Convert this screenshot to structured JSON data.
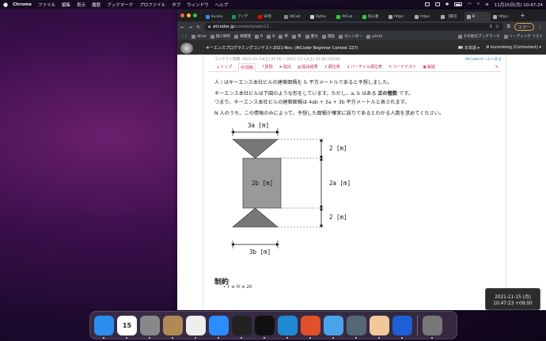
{
  "menubar": {
    "app": "Chrome",
    "menus": [
      "ファイル",
      "編集",
      "表示",
      "履歴",
      "ブックマーク",
      "プロファイル",
      "タブ",
      "ウィンドウ",
      "ヘルプ"
    ],
    "datetime": "11月15日(月) 10:47:24"
  },
  "browser": {
    "tabs": [
      {
        "label": "kuroro",
        "color": "#4285f4"
      },
      {
        "label": "アイデ",
        "color": "#0f9d58"
      },
      {
        "label": "90年",
        "color": "#ff0000"
      },
      {
        "label": "AtCod",
        "color": "#888888"
      },
      {
        "label": "Pytho",
        "color": "#cccccc"
      },
      {
        "label": "AtCod",
        "color": "#2ecc40"
      },
      {
        "label": "初心者",
        "color": "#2ecc40"
      },
      {
        "label": "https:",
        "color": "#aaaaaa"
      },
      {
        "label": "https:",
        "color": "#aaaaaa"
      },
      {
        "label": "【東京",
        "color": "#aaaaaa"
      },
      {
        "label": "B",
        "color": "#aaaaaa",
        "active": true
      },
      {
        "label": "https:",
        "color": "#aaaaaa"
      }
    ],
    "url_host": "atcoder.jp",
    "url_path": "/contests/abc22...",
    "error_pill": "エラー",
    "bookmarks": [
      {
        "label": "drive"
      },
      {
        "label": "個人制作"
      },
      {
        "label": "株関連"
      },
      {
        "label": "R"
      },
      {
        "label": "B"
      },
      {
        "label": "帝"
      },
      {
        "label": "青"
      },
      {
        "label": "書文"
      },
      {
        "label": "漫画"
      },
      {
        "label": "カレンダー"
      },
      {
        "label": "yenta"
      },
      {
        "label": "その他のブックマーク"
      },
      {
        "label": "リーディング リスト"
      }
    ]
  },
  "atcoder": {
    "contest_title": "キーエンスプログラミングコンテスト2021-Nov. (AtCoder Beginner Contest 227)",
    "language": "日本語",
    "user": "kurorobiog (Contestant)",
    "contest_time": "コンテスト時間: 2021-11-13(土) 21:00 ~ 2021-11-13(土) 22:40 (100分)",
    "home_link": "AtCoderホームへ戻る",
    "nav_tabs": [
      {
        "icon": "home-icon",
        "glyph": "⌂",
        "label": "トップ"
      },
      {
        "icon": "list-icon",
        "glyph": "▤",
        "label": "問題",
        "active": true
      },
      {
        "icon": "question-icon",
        "glyph": "?",
        "label": "質問"
      },
      {
        "icon": "send-icon",
        "glyph": "➤",
        "label": "提出"
      },
      {
        "icon": "submissions-icon",
        "glyph": "▤",
        "label": "提出結果"
      },
      {
        "icon": "ranking-icon",
        "glyph": "↕",
        "label": "順位表"
      },
      {
        "icon": "virtual-ranking-icon",
        "glyph": "↕",
        "label": "バーチャル順位表"
      },
      {
        "icon": "code-icon",
        "glyph": "✎",
        "label": "コードテスト"
      },
      {
        "icon": "book-icon",
        "glyph": "▣",
        "label": "解説"
      }
    ],
    "statement": {
      "line1": "人 i はキーエンス本社ビルの建築面積を Sᵢ 平方メートルであると予想しました。",
      "line2a": "キーエンス本社ビルは下図のような形をしています。ただし、a, b はある ",
      "line2b": "正の整数",
      "line2c": " です。",
      "line3": "つまり、キーエンス本社ビルの建築面積は 4ab + 3a + 3b 平方メートルと表されます。",
      "line4": "N 人のうち、この情報のみによって、予想した面積が確実に誤りであるとわかる人数を求めてください。"
    },
    "figure": {
      "top_width": "3a [m]",
      "bottom_width": "3b [m]",
      "rect_label": "2b [m]",
      "top_height": "2 [m]",
      "middle_height": "2a [m]",
      "bottom_height": "2 [m]"
    },
    "constraints_heading": "制約",
    "constraint1": "1 ≤ N ≤ 20"
  },
  "dock": [
    {
      "name": "finder-icon",
      "color": "#2a8ef0"
    },
    {
      "name": "calendar-icon",
      "color": "#ffffff",
      "text": "15"
    },
    {
      "name": "system-preferences-icon",
      "color": "#888888"
    },
    {
      "name": "contacts-icon",
      "color": "#b08a55"
    },
    {
      "name": "chrome-icon",
      "color": "#eeeeee"
    },
    {
      "name": "zoom-icon",
      "color": "#2d8cff"
    },
    {
      "name": "terminal-icon",
      "color": "#222222"
    },
    {
      "name": "terminal-alt-icon",
      "color": "#111111"
    },
    {
      "name": "vscode-icon",
      "color": "#1f8ad2"
    },
    {
      "name": "activity-monitor-icon",
      "color": "#e0502a"
    },
    {
      "name": "docker-icon",
      "color": "#4aa3e8"
    },
    {
      "name": "quicktime-icon",
      "color": "#556677"
    },
    {
      "name": "preview-icon",
      "color": "#f0c89a"
    },
    {
      "name": "infinity-app-icon",
      "color": "#1e5fd8"
    },
    {
      "name": "trash-icon",
      "color": "#777777"
    }
  ],
  "clock_widget": {
    "date": "2021-11-15 (月)",
    "time": "10:47:23 +09:00"
  }
}
